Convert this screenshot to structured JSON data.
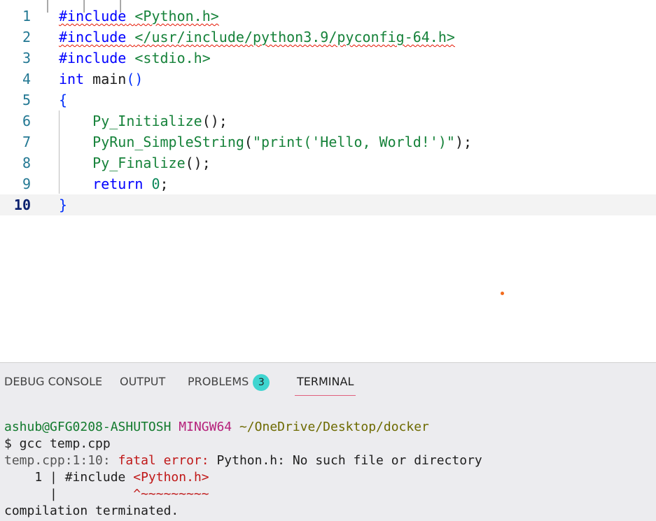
{
  "editor": {
    "lines": [
      {
        "n": "1",
        "parts": [
          {
            "t": "#include",
            "c": "kw-pre",
            "sq": true
          },
          {
            "t": " ",
            "c": "punc",
            "sq": true
          },
          {
            "t": "<Python.h>",
            "c": "inc",
            "sq": true
          }
        ]
      },
      {
        "n": "2",
        "parts": [
          {
            "t": "#include",
            "c": "kw-pre",
            "sq": true
          },
          {
            "t": " ",
            "c": "punc",
            "sq": true
          },
          {
            "t": "</usr/include/python3.9/pyconfig-64.h>",
            "c": "inc",
            "sq": true
          }
        ]
      },
      {
        "n": "3",
        "parts": [
          {
            "t": "#include",
            "c": "kw-pre"
          },
          {
            "t": " ",
            "c": "punc"
          },
          {
            "t": "<stdio.h>",
            "c": "inc"
          }
        ]
      },
      {
        "n": "4",
        "parts": [
          {
            "t": "int",
            "c": "kw"
          },
          {
            "t": " ",
            "c": "punc"
          },
          {
            "t": "main",
            "c": "punc"
          },
          {
            "t": "()",
            "c": "brace-blue"
          }
        ]
      },
      {
        "n": "5",
        "parts": [
          {
            "t": "{",
            "c": "brace-blue"
          }
        ]
      },
      {
        "n": "6",
        "parts": [
          {
            "t": "    ",
            "c": "punc"
          },
          {
            "t": "Py_Initialize",
            "c": "fn"
          },
          {
            "t": "();",
            "c": "punc"
          }
        ]
      },
      {
        "n": "7",
        "parts": [
          {
            "t": "    ",
            "c": "punc"
          },
          {
            "t": "PyRun_SimpleString",
            "c": "fn"
          },
          {
            "t": "(",
            "c": "punc"
          },
          {
            "t": "\"print('Hello, World!')\"",
            "c": "strg"
          },
          {
            "t": ");",
            "c": "punc"
          }
        ]
      },
      {
        "n": "8",
        "parts": [
          {
            "t": "    ",
            "c": "punc"
          },
          {
            "t": "Py_Finalize",
            "c": "fn"
          },
          {
            "t": "();",
            "c": "punc"
          }
        ]
      },
      {
        "n": "9",
        "parts": [
          {
            "t": "    ",
            "c": "punc"
          },
          {
            "t": "return",
            "c": "kw"
          },
          {
            "t": " ",
            "c": "punc"
          },
          {
            "t": "0",
            "c": "num"
          },
          {
            "t": ";",
            "c": "punc"
          }
        ]
      },
      {
        "n": "10",
        "parts": [
          {
            "t": "}",
            "c": "brace-blue"
          }
        ],
        "current": true
      }
    ]
  },
  "panel": {
    "tabs": [
      {
        "label": "DEBUG CONSOLE",
        "active": false
      },
      {
        "label": "OUTPUT",
        "active": false
      },
      {
        "label": "PROBLEMS",
        "active": false,
        "badge": "3"
      },
      {
        "label": "TERMINAL",
        "active": true
      }
    ],
    "terminal": {
      "prompt_user": "ashub@GFG0208-ASHUTOSH",
      "prompt_env": "MINGW64",
      "prompt_path": "~/OneDrive/Desktop/docker",
      "command": "$ gcc temp.cpp",
      "error_loc": "temp.cpp:1:10:",
      "error_label": "fatal error:",
      "error_msg": "Python.h: No such file or directory",
      "src_lineno": "    1 | ",
      "src_code": "#include ",
      "src_highlight": "<Python.h>",
      "caret_prefix": "      |          ",
      "caret": "^~~~~~~~~~",
      "final": "compilation terminated."
    }
  }
}
